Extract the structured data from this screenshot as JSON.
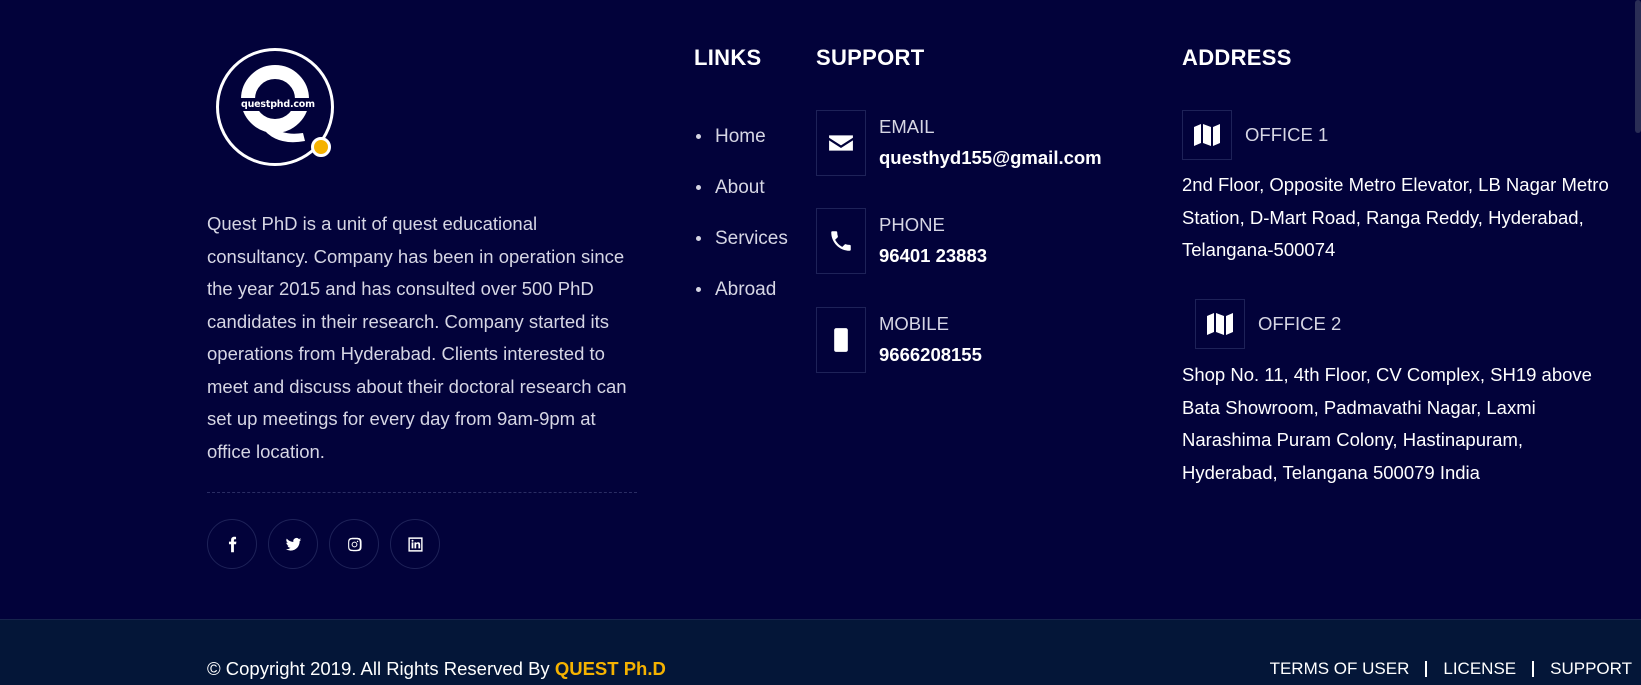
{
  "logo": {
    "text": "questphd.com",
    "accent_color": "#f5b200"
  },
  "about": {
    "text": "Quest PhD is a unit of quest educational consultancy. Company has been in operation since the year 2015 and has consulted over 500 PhD candidates in their research. Company started its operations from Hyderabad. Clients interested to meet and discuss about their doctoral research can set up meetings for every day from 9am-9pm at office location."
  },
  "socials": [
    {
      "icon": "facebook-icon"
    },
    {
      "icon": "twitter-icon"
    },
    {
      "icon": "instagram-icon"
    },
    {
      "icon": "linkedin-icon"
    }
  ],
  "links": {
    "heading": "LINKS",
    "items": [
      "Home",
      "About",
      "Services",
      "Abroad"
    ]
  },
  "support": {
    "heading": "SUPPORT",
    "items": [
      {
        "icon": "envelope-icon",
        "label": "EMAIL",
        "value": "questhyd155@gmail.com"
      },
      {
        "icon": "phone-icon",
        "label": "PHONE",
        "value": "96401 23883"
      },
      {
        "icon": "mobile-icon",
        "label": "MOBILE",
        "value": "9666208155"
      }
    ]
  },
  "address": {
    "heading": "ADDRESS",
    "offices": [
      {
        "icon": "map-icon",
        "label": "OFFICE 1",
        "text": "2nd Floor, Opposite Metro Elevator, LB Nagar Metro Station, D-Mart Road, Ranga Reddy, Hyderabad, Telangana-500074"
      },
      {
        "icon": "map-icon",
        "label": "OFFICE 2",
        "text": "Shop No. 11, 4th Floor, CV Complex, SH19 above Bata Showroom, Padmavathi Nagar, Laxmi Narashima Puram Colony, Hastinapuram, Hyderabad, Telangana 500079 India"
      }
    ]
  },
  "bottom": {
    "copyright": "© Copyright 2019. All Rights Reserved By",
    "brand": "QUEST Ph.D",
    "links": [
      "TERMS OF USER",
      "LICENSE",
      "SUPPORT"
    ]
  },
  "colors": {
    "background": "#02023a",
    "bottom_bar": "#041638",
    "accent": "#f5b200"
  }
}
